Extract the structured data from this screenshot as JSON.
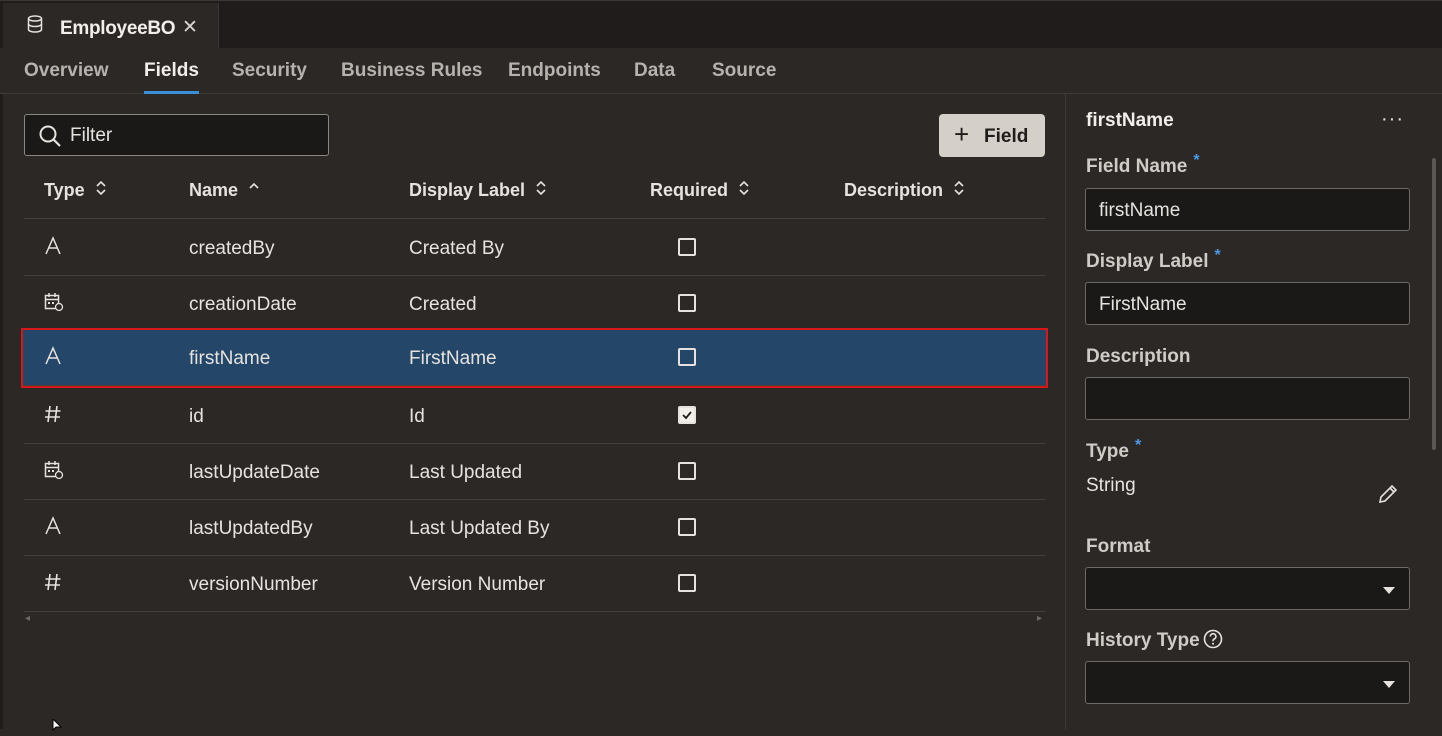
{
  "doc_tab": {
    "title": "EmployeeBO",
    "close": "✕",
    "icon": "database-icon"
  },
  "subtabs": [
    "Overview",
    "Fields",
    "Security",
    "Business Rules",
    "Endpoints",
    "Data",
    "Source"
  ],
  "active_subtab": "Fields",
  "filter": {
    "value": "Filter"
  },
  "add_field_button": {
    "plus": "+",
    "label": "Field"
  },
  "table": {
    "columns": [
      "Type",
      "Name",
      "Display Label",
      "Required",
      "Description"
    ],
    "sorted_column": "Name",
    "rows": [
      {
        "type_icon": "text-type-icon",
        "name": "createdBy",
        "label": "Created By",
        "required": false,
        "description": ""
      },
      {
        "type_icon": "date-type-icon",
        "name": "creationDate",
        "label": "Created",
        "required": false,
        "description": ""
      },
      {
        "type_icon": "text-type-icon",
        "name": "firstName",
        "label": "FirstName",
        "required": false,
        "description": "",
        "selected": true
      },
      {
        "type_icon": "number-type-icon",
        "name": "id",
        "label": "Id",
        "required": true,
        "description": ""
      },
      {
        "type_icon": "date-type-icon",
        "name": "lastUpdateDate",
        "label": "Last Updated",
        "required": false,
        "description": ""
      },
      {
        "type_icon": "text-type-icon",
        "name": "lastUpdatedBy",
        "label": "Last Updated By",
        "required": false,
        "description": ""
      },
      {
        "type_icon": "number-type-icon",
        "name": "versionNumber",
        "label": "Version Number",
        "required": false,
        "description": ""
      }
    ]
  },
  "panel": {
    "title": "firstName",
    "more": "···",
    "field_name_label": "Field Name",
    "field_name_value": "firstName",
    "display_label_label": "Display Label",
    "display_label_value": "FirstName",
    "description_label": "Description",
    "description_value": "",
    "type_label": "Type",
    "type_value": "String",
    "format_label": "Format",
    "history_type_label": "History Type",
    "required_mark": "*"
  },
  "colors": {
    "selected_row": "#234669",
    "selection_outline": "#d8171b",
    "accent": "#3b8fd6"
  }
}
